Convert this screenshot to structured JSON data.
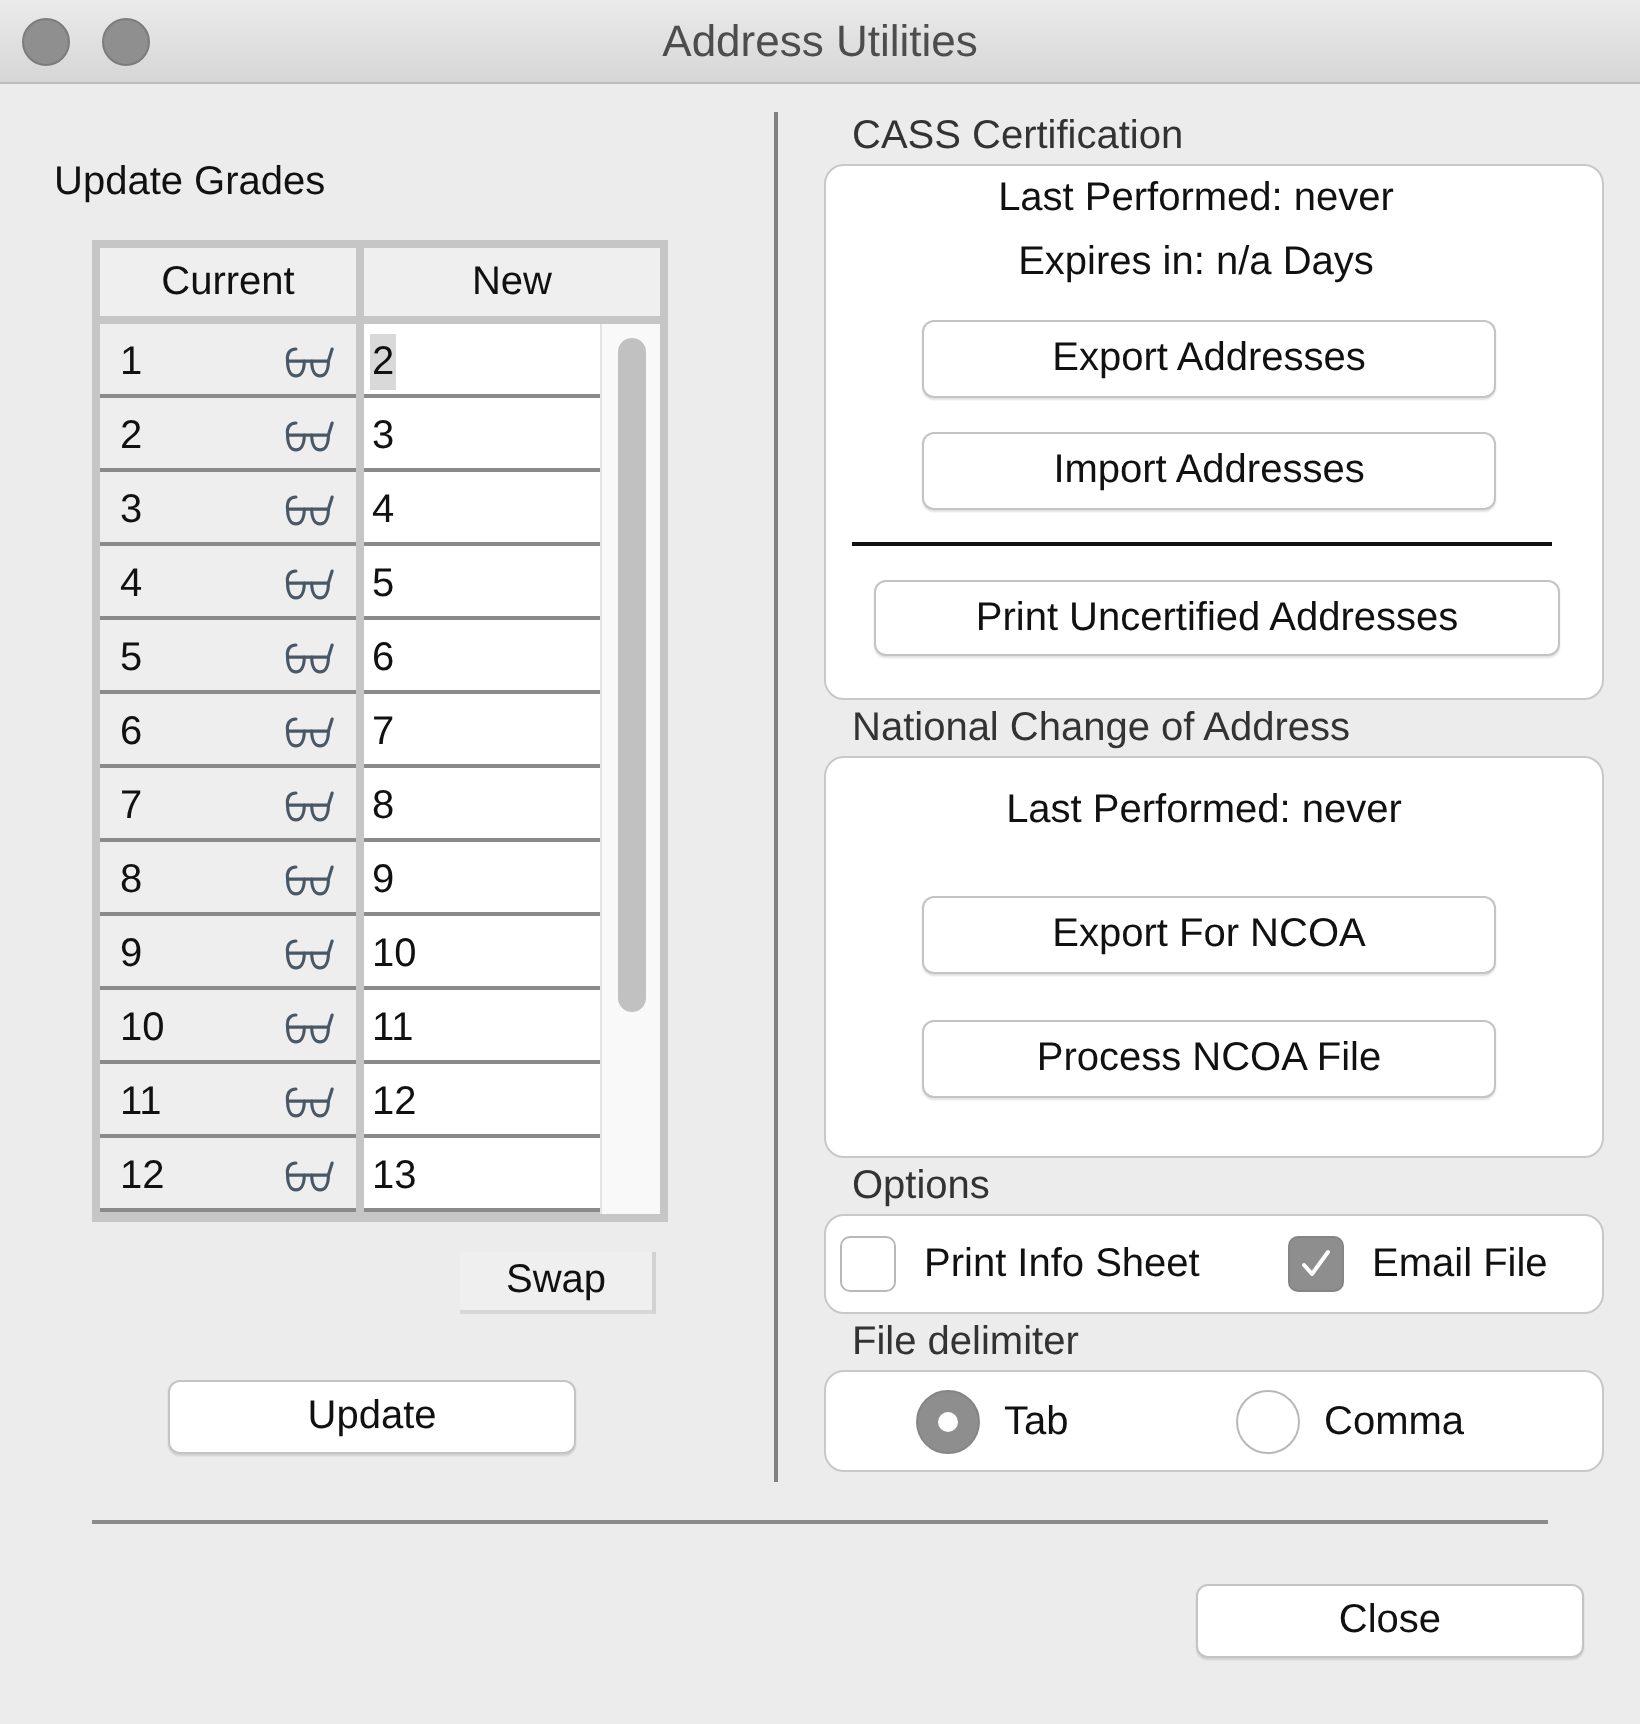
{
  "window": {
    "title": "Address Utilities"
  },
  "update_grades": {
    "label": "Update Grades",
    "columns": [
      "Current",
      "New"
    ],
    "rows": [
      {
        "current": "1",
        "new": "2",
        "selected": true
      },
      {
        "current": "2",
        "new": "3",
        "selected": false
      },
      {
        "current": "3",
        "new": "4",
        "selected": false
      },
      {
        "current": "4",
        "new": "5",
        "selected": false
      },
      {
        "current": "5",
        "new": "6",
        "selected": false
      },
      {
        "current": "6",
        "new": "7",
        "selected": false
      },
      {
        "current": "7",
        "new": "8",
        "selected": false
      },
      {
        "current": "8",
        "new": "9",
        "selected": false
      },
      {
        "current": "9",
        "new": "10",
        "selected": false
      },
      {
        "current": "10",
        "new": "11",
        "selected": false
      },
      {
        "current": "11",
        "new": "12",
        "selected": false
      },
      {
        "current": "12",
        "new": "13",
        "selected": false
      }
    ],
    "swap_button": "Swap",
    "update_button": "Update"
  },
  "cass_certification": {
    "label": "CASS Certification",
    "lines": [
      "Last Performed: never",
      "Expires in: n/a Days"
    ],
    "buttons": [
      "Export Addresses",
      "Import Addresses"
    ],
    "print_button": "Print Uncertified Addresses"
  },
  "national_change_of_address": {
    "label": "National Change of Address",
    "lines": [
      "Last Performed: never"
    ],
    "buttons": [
      "Export For NCOA",
      "Process NCOA File"
    ]
  },
  "options": {
    "label": "Options",
    "checkboxes": [
      {
        "label": "Print Info Sheet",
        "checked": false
      },
      {
        "label": "Email File",
        "checked": true
      }
    ]
  },
  "file_delimiter": {
    "label": "File delimiter",
    "radios": [
      {
        "label": "Tab",
        "selected": true
      },
      {
        "label": "Comma",
        "selected": false
      }
    ]
  },
  "close_button": "Close"
}
